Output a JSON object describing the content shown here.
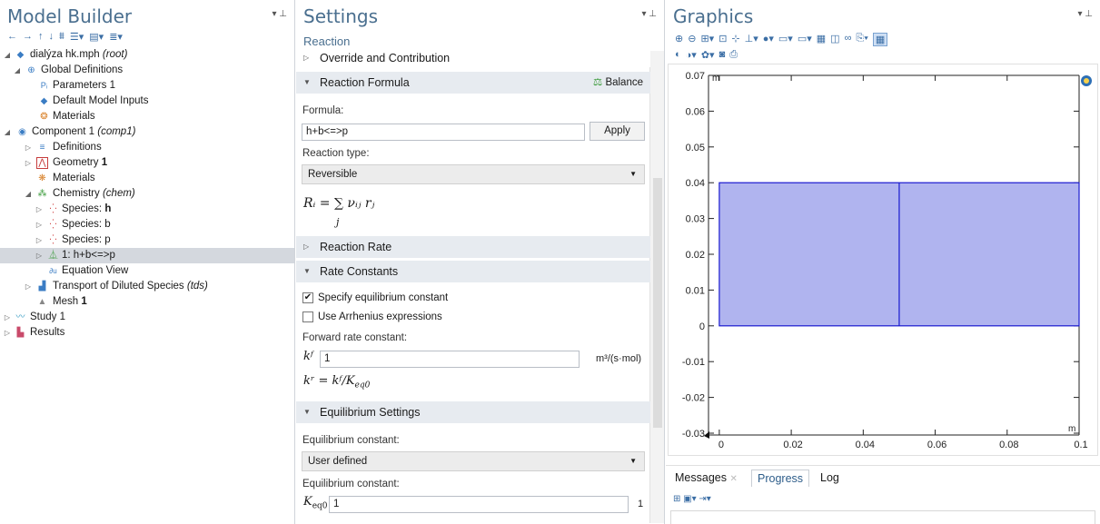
{
  "model_builder": {
    "title": "Model Builder",
    "toolbar_icons": [
      "back-arrow-icon",
      "forward-arrow-icon",
      "up-arrow-icon",
      "down-arrow-icon",
      "show-more-icon",
      "expand-icon",
      "collapse-icon",
      "list-icon"
    ],
    "tree": {
      "root": {
        "name": "dialýza hk.mph",
        "tag": "(root)"
      },
      "global_definitions": "Global Definitions",
      "parameters": "Parameters 1",
      "default_inputs": "Default Model Inputs",
      "materials_global": "Materials",
      "component": {
        "name": "Component 1",
        "tag": "(comp1)"
      },
      "definitions": "Definitions",
      "geometry": {
        "name": "Geometry",
        "num": "1"
      },
      "materials": "Materials",
      "chemistry": {
        "name": "Chemistry",
        "tag": "(chem)"
      },
      "species_h": {
        "prefix": "Species: ",
        "name": "h"
      },
      "species_b": "Species: b",
      "species_p": "Species: p",
      "reaction": "1: h+b<=>p",
      "equation_view": "Equation View",
      "transport": {
        "name": "Transport of Diluted Species",
        "tag": "(tds)"
      },
      "mesh": {
        "name": "Mesh",
        "num": "1"
      },
      "study": "Study 1",
      "results": "Results"
    }
  },
  "settings": {
    "title": "Settings",
    "subtitle": "Reaction",
    "sections": {
      "override": "Override and Contribution",
      "reaction_formula": "Reaction Formula",
      "balance": "Balance",
      "reaction_rate": "Reaction Rate",
      "rate_constants": "Rate Constants",
      "equilibrium_settings": "Equilibrium Settings"
    },
    "formula_label": "Formula:",
    "formula_value": "h+b<=>p",
    "apply_label": "Apply",
    "reaction_type_label": "Reaction type:",
    "reaction_type_value": "Reversible",
    "rate_expr": "Rᵢ = ∑ νᵢⱼ rⱼ",
    "rate_expr_sub": "j",
    "specify_eq_label": "Specify equilibrium constant",
    "specify_eq_checked": true,
    "arrhenius_label": "Use Arrhenius expressions",
    "arrhenius_checked": false,
    "forward_rate_label": "Forward rate constant:",
    "kf_symbol": "kᶠ",
    "kf_value": "1",
    "kf_unit": "m³/(s·mol)",
    "kr_expr": "kʳ = kᶠ/K",
    "kr_sub": "eq0",
    "eq_constant_label": "Equilibrium constant:",
    "eq_constant_select": "User defined",
    "eq_constant_label2": "Equilibrium constant:",
    "keq_symbol": "K",
    "keq_sub": "eq0",
    "keq_value": "1",
    "keq_unit": "1"
  },
  "graphics": {
    "title": "Graphics",
    "toolbar_row1": [
      "zoom-in-icon",
      "zoom-out-icon",
      "zoom-box-icon",
      "zoom-extents-icon",
      "grid-icon",
      "axis-icon",
      "render-icon",
      "wireframe-icon",
      "select-icon",
      "view-icon",
      "transparency-icon",
      "image-icon",
      "screenshot-icon",
      "active-icon"
    ],
    "toolbar_row2": [
      "light-icon",
      "scene-icon",
      "settings-icon",
      "camera-icon",
      "print-icon"
    ],
    "plot": {
      "y_ticks": [
        "0.07",
        "0.06",
        "0.05",
        "0.04",
        "0.03",
        "0.02",
        "0.01",
        "0",
        "-0.01",
        "-0.02",
        "-0.03"
      ],
      "x_ticks": [
        "0",
        "0.02",
        "0.04",
        "0.06",
        "0.08",
        "0.1"
      ],
      "unit_y": "m",
      "unit_x": "m",
      "rect_fill": "#b0b4ef",
      "rect_stroke": "#1a1ad0"
    },
    "tabs": {
      "messages": "Messages",
      "progress": "Progress",
      "log": "Log"
    }
  }
}
